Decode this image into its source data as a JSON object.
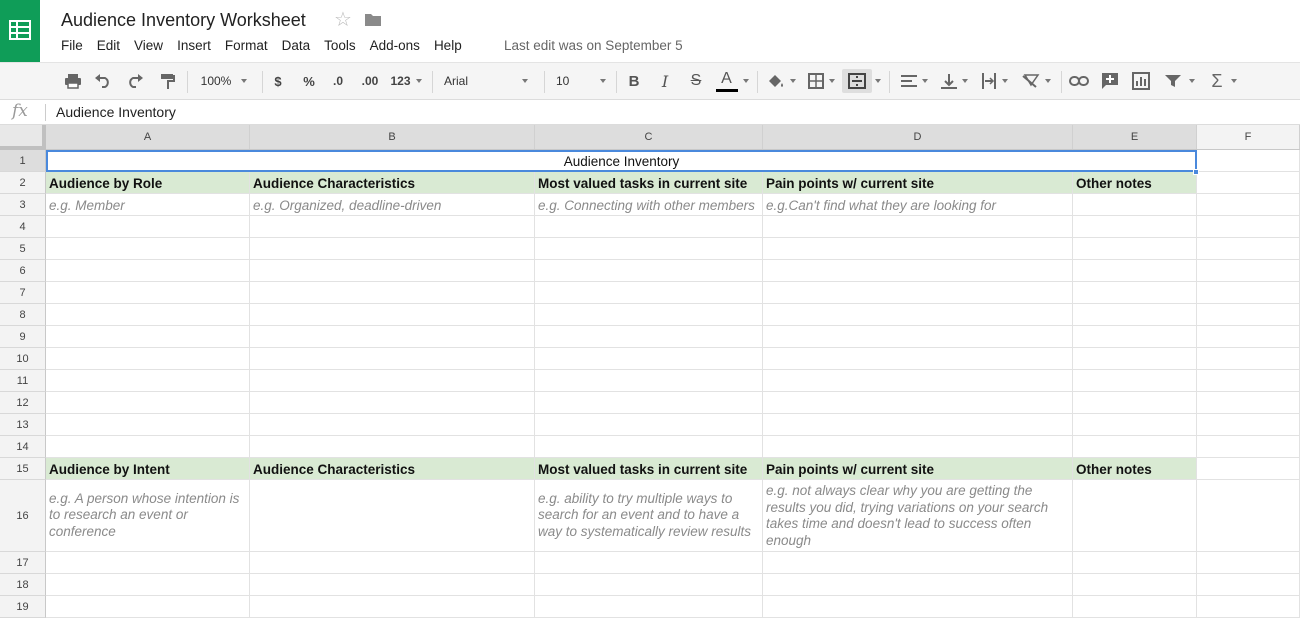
{
  "app": {
    "title": "Audience Inventory Worksheet",
    "last_edit": "Last edit was on September 5",
    "accent_color": "#0f9d58"
  },
  "menu": [
    "File",
    "Edit",
    "View",
    "Insert",
    "Format",
    "Data",
    "Tools",
    "Add-ons",
    "Help"
  ],
  "toolbar": {
    "zoom": "100%",
    "currency": "$",
    "percent": "%",
    "decrease_decimal": ".0",
    "increase_decimal": ".00",
    "more_formats": "123",
    "font": "Arial",
    "font_size": "10",
    "bold": "B",
    "italic": "I",
    "strikethrough": "S",
    "text_color": "A"
  },
  "formula_bar": {
    "fx_label": "fx",
    "value": "Audience Inventory"
  },
  "columns": [
    "A",
    "B",
    "C",
    "D",
    "E",
    "F"
  ],
  "row_numbers": [
    "1",
    "2",
    "3",
    "4",
    "5",
    "6",
    "7",
    "8",
    "9",
    "10",
    "11",
    "12",
    "13",
    "14",
    "15",
    "16",
    "17",
    "18",
    "19"
  ],
  "sheet": {
    "title": "Audience Inventory",
    "role_header": [
      "Audience by Role",
      "Audience Characteristics",
      "Most valued tasks in current site",
      "Pain points w/ current site",
      "Other notes"
    ],
    "role_example": [
      "e.g. Member",
      "e.g. Organized, deadline-driven",
      "e.g. Connecting with other members",
      "e.g.Can't find what they are looking for",
      ""
    ],
    "intent_header": [
      "Audience by Intent",
      "Audience Characteristics",
      "Most valued tasks in current site",
      "Pain points w/ current site",
      "Other notes"
    ],
    "intent_example": [
      "e.g. A person whose intention is to research an event or conference",
      "",
      "e.g. ability to try multiple ways to search for an event and to have a way to systematically review results",
      "e.g. not always clear why you are getting the results you did, trying variations on your search takes time and doesn't lead to success often enough",
      ""
    ]
  }
}
